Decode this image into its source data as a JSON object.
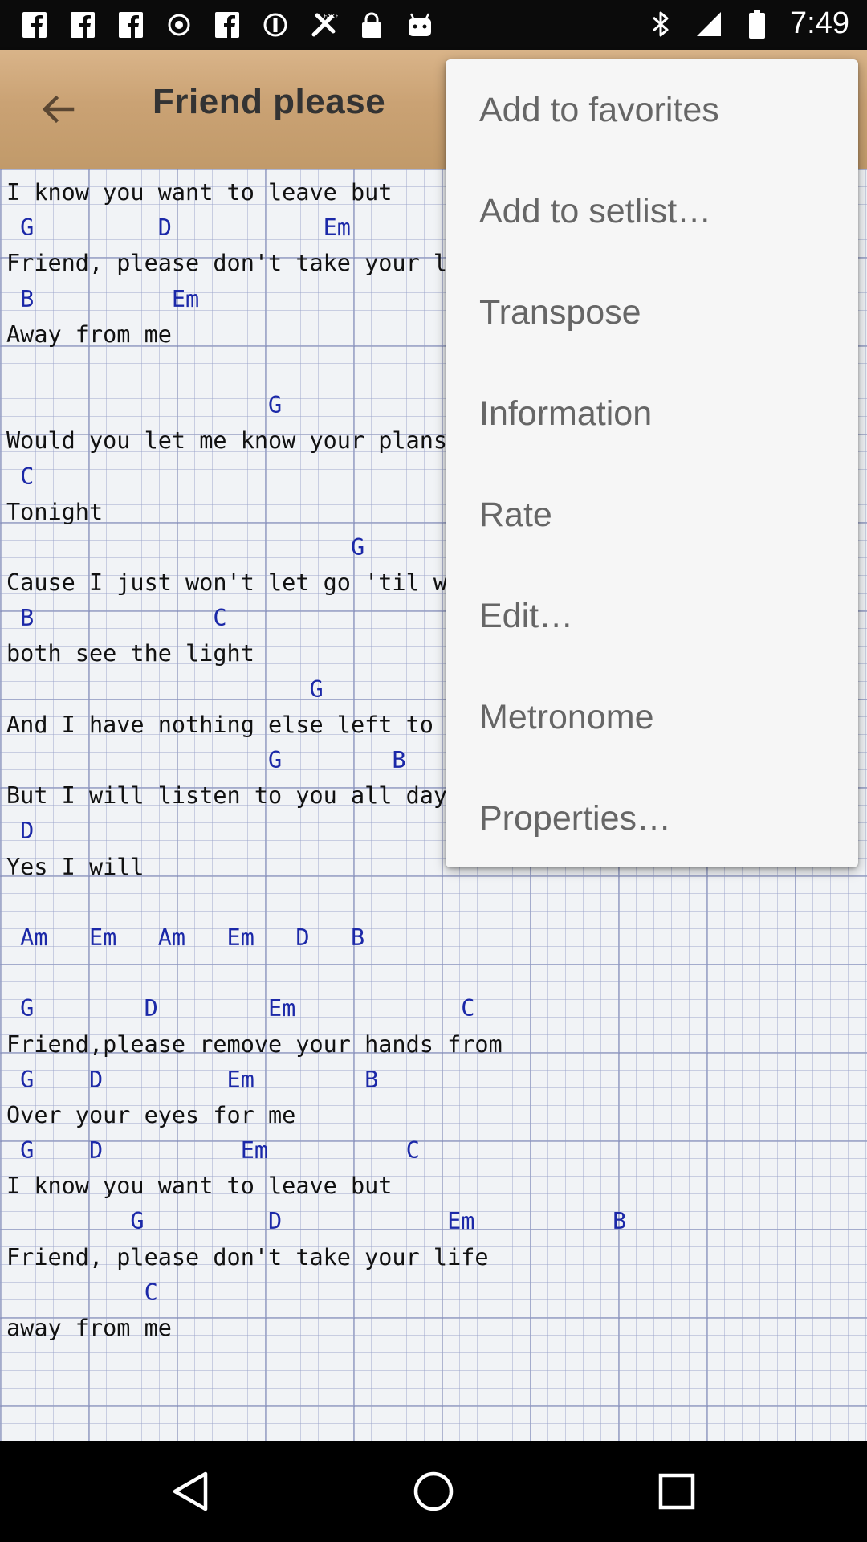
{
  "status_bar": {
    "time": "7:49",
    "icons": [
      "facebook-icon",
      "facebook-icon",
      "facebook-icon",
      "settings-dot-icon",
      "facebook-icon",
      "blocked-icon",
      "location-fake-icon",
      "lock-icon",
      "android-icon",
      "bluetooth-icon",
      "signal-icon",
      "battery-icon"
    ]
  },
  "app_bar": {
    "title": "Friend please"
  },
  "song": {
    "lines": [
      {
        "type": "lyric",
        "text": "I know you want to leave but"
      },
      {
        "type": "chord",
        "text": " G         D           Em"
      },
      {
        "type": "lyric",
        "text": "Friend, please don't take your l"
      },
      {
        "type": "chord",
        "text": " B          Em"
      },
      {
        "type": "lyric",
        "text": "Away from me"
      },
      {
        "type": "blank",
        "text": ""
      },
      {
        "type": "chord",
        "text": "                   G"
      },
      {
        "type": "lyric",
        "text": "Would you let me know your plans"
      },
      {
        "type": "chord",
        "text": " C"
      },
      {
        "type": "lyric",
        "text": "Tonight"
      },
      {
        "type": "chord",
        "text": "                         G"
      },
      {
        "type": "lyric",
        "text": "Cause I just won't let go 'til w"
      },
      {
        "type": "chord",
        "text": " B             C"
      },
      {
        "type": "lyric",
        "text": "both see the light"
      },
      {
        "type": "chord",
        "text": "                      G"
      },
      {
        "type": "lyric",
        "text": "And I have nothing else left to"
      },
      {
        "type": "chord",
        "text": "                   G        B"
      },
      {
        "type": "lyric",
        "text": "But I will listen to you all day"
      },
      {
        "type": "chord",
        "text": " D"
      },
      {
        "type": "lyric",
        "text": "Yes I will"
      },
      {
        "type": "blank",
        "text": ""
      },
      {
        "type": "chord",
        "text": " Am   Em   Am   Em   D   B"
      },
      {
        "type": "blank",
        "text": ""
      },
      {
        "type": "chord",
        "text": " G        D        Em            C"
      },
      {
        "type": "lyric",
        "text": "Friend,please remove your hands from"
      },
      {
        "type": "chord",
        "text": " G    D         Em        B"
      },
      {
        "type": "lyric",
        "text": "Over your eyes for me"
      },
      {
        "type": "chord",
        "text": " G    D          Em          C"
      },
      {
        "type": "lyric",
        "text": "I know you want to leave but"
      },
      {
        "type": "chord",
        "text": "         G         D            Em          B"
      },
      {
        "type": "lyric",
        "text": "Friend, please don't take your life"
      },
      {
        "type": "chord",
        "text": "          C"
      },
      {
        "type": "lyric",
        "text": "away from me"
      }
    ]
  },
  "menu": {
    "items": [
      {
        "label": "Add to favorites"
      },
      {
        "label": "Add to setlist…"
      },
      {
        "label": "Transpose"
      },
      {
        "label": "Information"
      },
      {
        "label": "Rate"
      },
      {
        "label": "Edit…"
      },
      {
        "label": "Metronome"
      },
      {
        "label": "Properties…"
      }
    ]
  },
  "nav_bar": {
    "icons": [
      "back-triangle-icon",
      "home-circle-icon",
      "recents-square-icon"
    ]
  }
}
